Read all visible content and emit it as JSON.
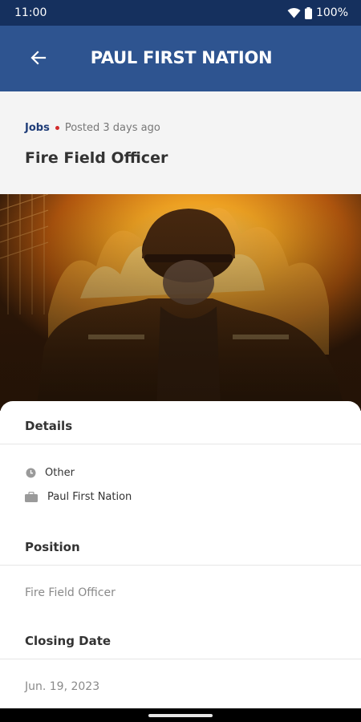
{
  "status_bar": {
    "time": "11:00",
    "battery": "100%",
    "icons": [
      "wifi-icon",
      "battery-icon"
    ]
  },
  "app_bar": {
    "title": "PAUL FIRST NATION",
    "back_icon": "arrow-left-icon"
  },
  "post": {
    "category": "Jobs",
    "posted": "Posted 3 days ago",
    "title": "Fire Field Officer"
  },
  "details": {
    "heading": "Details",
    "items": [
      {
        "icon": "clock-icon",
        "label": "Other"
      },
      {
        "icon": "briefcase-icon",
        "label": "Paul First Nation"
      }
    ]
  },
  "position": {
    "heading": "Position",
    "value": "Fire Field Officer"
  },
  "closing_date": {
    "heading": "Closing Date",
    "value": "Jun. 19, 2023"
  },
  "colors": {
    "status_bar": "#15305e",
    "app_bar": "#2e5490",
    "category": "#1f3d78",
    "dot": "#d22b2b"
  }
}
